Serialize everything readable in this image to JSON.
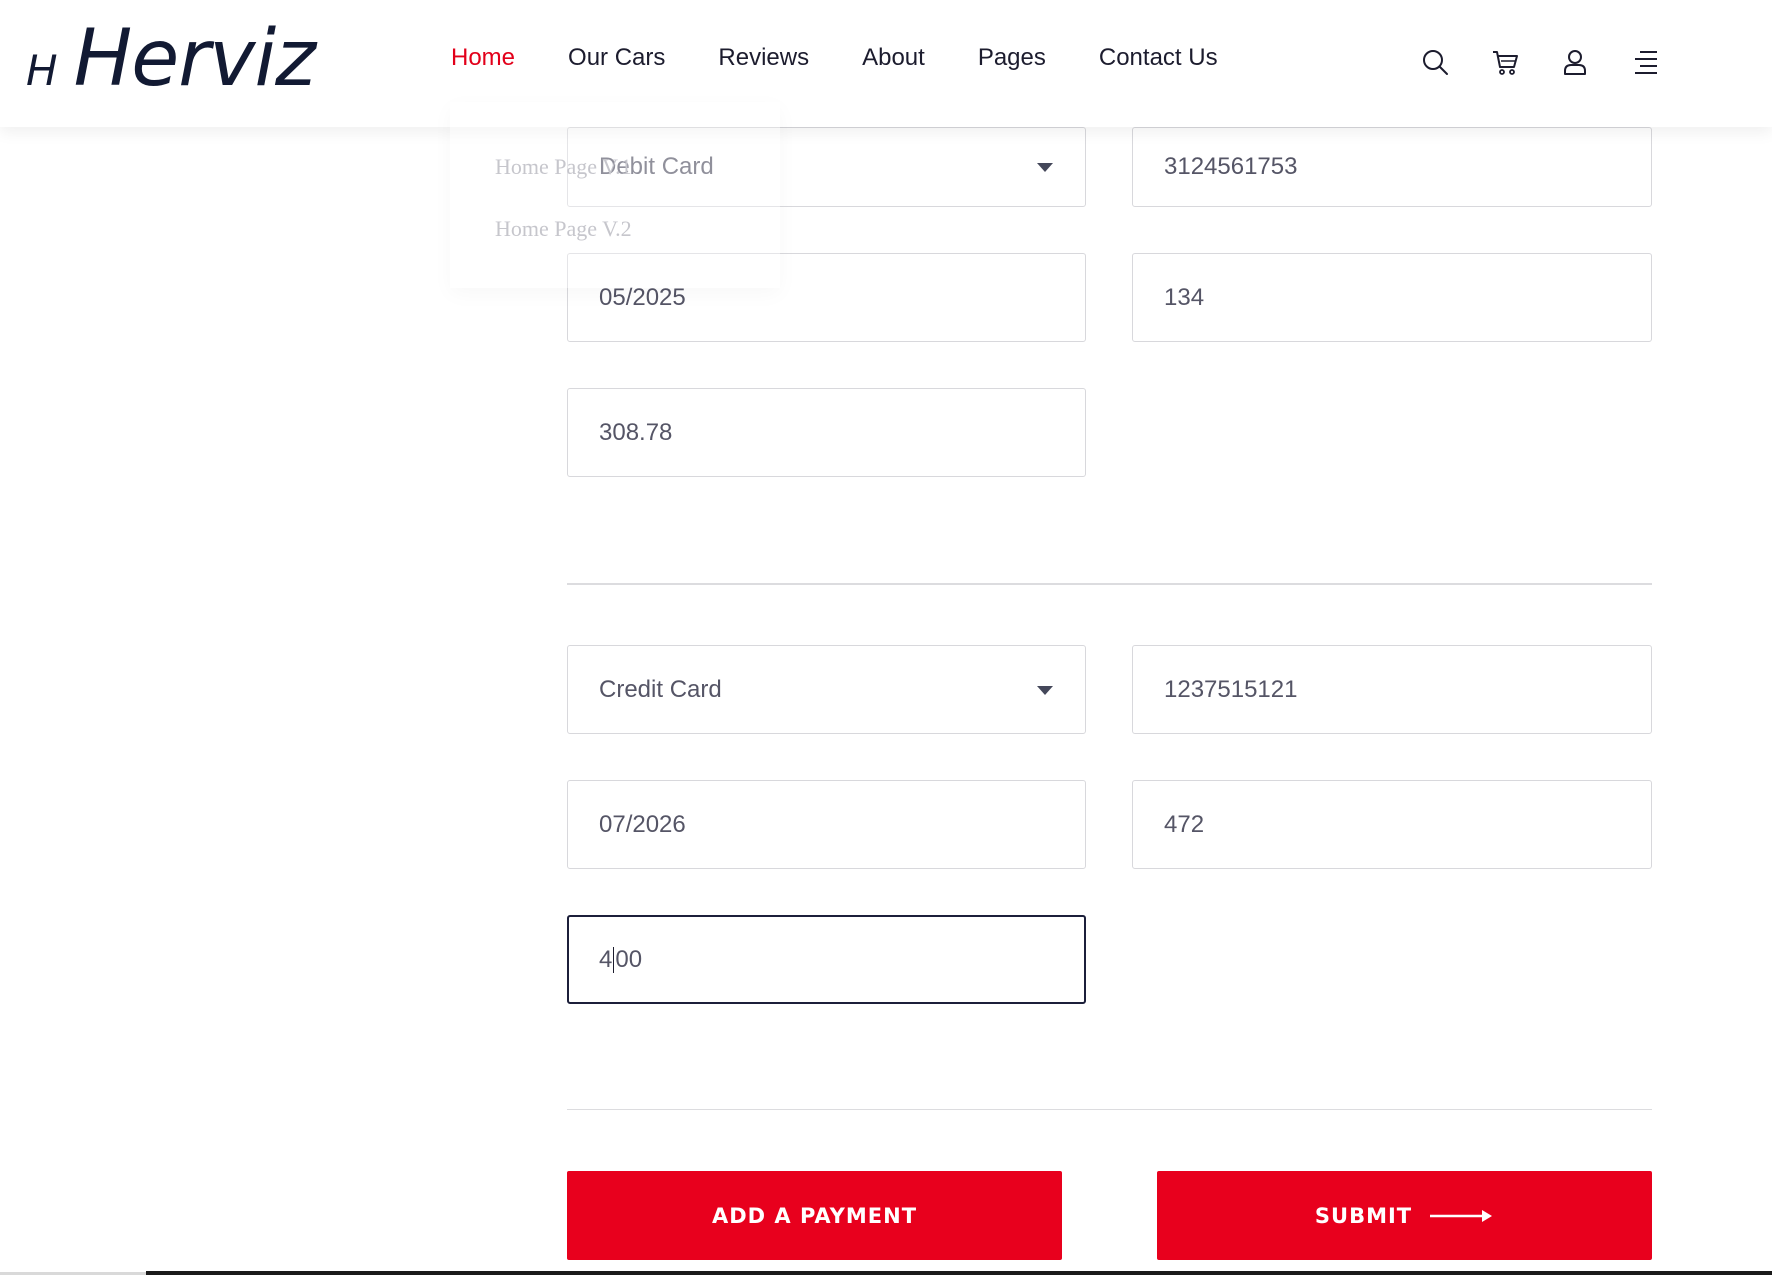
{
  "brand": {
    "mark": "H",
    "name": "Herviz"
  },
  "nav": {
    "items": [
      {
        "label": "Home",
        "active": true
      },
      {
        "label": "Our Cars",
        "active": false
      },
      {
        "label": "Reviews",
        "active": false
      },
      {
        "label": "About",
        "active": false
      },
      {
        "label": "Pages",
        "active": false
      },
      {
        "label": "Contact Us",
        "active": false
      }
    ],
    "icons": [
      "search-icon",
      "cart-icon",
      "user-icon",
      "menu-icon"
    ]
  },
  "home_dropdown": {
    "items": [
      "Home Page V.1",
      "Home Page V.2"
    ]
  },
  "payment_1": {
    "method": "Debit Card",
    "card_number": "3124561753",
    "expiry": "05/2025",
    "cvv": "134",
    "amount": "308.78"
  },
  "payment_2": {
    "method": "Credit Card",
    "card_number": "1237515121",
    "expiry": "07/2026",
    "cvv": "472",
    "amount_before_cursor": "4",
    "amount_after_cursor": "00"
  },
  "actions": {
    "add_payment": "ADD A PAYMENT",
    "submit": "SUBMIT"
  },
  "colors": {
    "accent": "#e8001d",
    "nav_active": "#e2001a",
    "brand_dark": "#121a33"
  }
}
